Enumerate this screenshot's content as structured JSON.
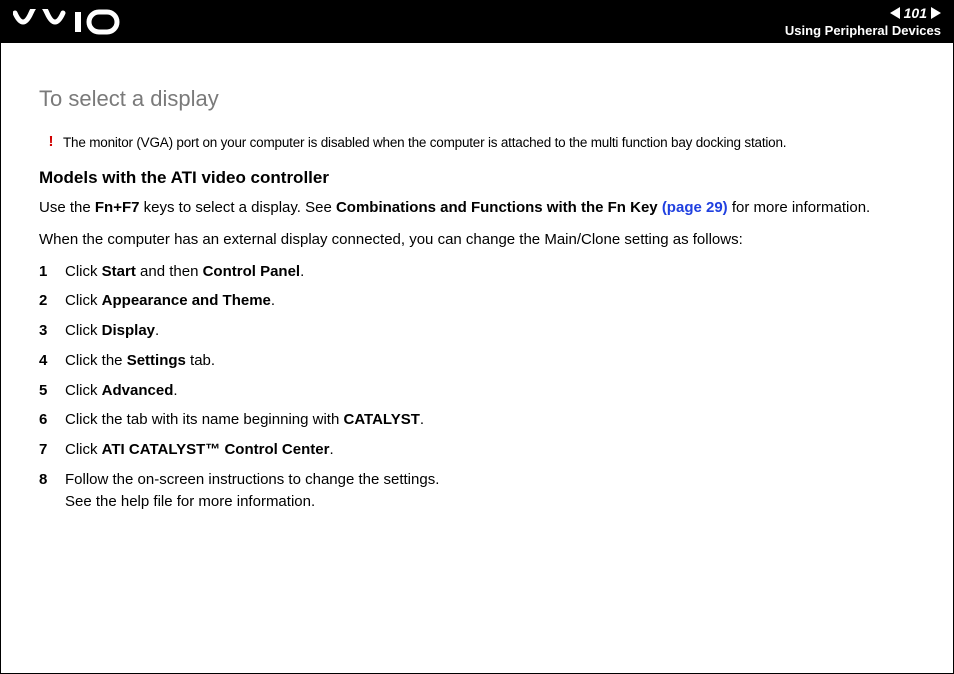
{
  "header": {
    "page_number": "101",
    "section_label": "Using Peripheral Devices"
  },
  "content": {
    "title": "To select a display",
    "note_mark": "!",
    "note_text": "The monitor (VGA) port on your computer is disabled when the computer is attached to the multi function bay docking station.",
    "subheading": "Models with the ATI video controller",
    "para1_pre": "Use the ",
    "para1_keys": "Fn+F7",
    "para1_mid": " keys to select a display. See ",
    "para1_link_label": "Combinations and Functions with the Fn Key",
    "para1_link_page": "(page 29)",
    "para1_post": " for more information.",
    "para2": "When the computer has an external display connected, you can change the Main/Clone setting as follows:",
    "steps": [
      {
        "n": "1",
        "pre": "Click ",
        "b1": "Start",
        "mid": " and then ",
        "b2": "Control Panel",
        "post": "."
      },
      {
        "n": "2",
        "pre": "Click ",
        "b1": "Appearance and Theme",
        "post": "."
      },
      {
        "n": "3",
        "pre": "Click ",
        "b1": "Display",
        "post": "."
      },
      {
        "n": "4",
        "pre": "Click the ",
        "b1": "Settings",
        "post": " tab."
      },
      {
        "n": "5",
        "pre": "Click ",
        "b1": "Advanced",
        "post": "."
      },
      {
        "n": "6",
        "pre": "Click the tab with its name beginning with ",
        "b1": "CATALYST",
        "post": "."
      },
      {
        "n": "7",
        "pre": "Click ",
        "b1": "ATI CATALYST™ Control Center",
        "post": "."
      },
      {
        "n": "8",
        "pre": "Follow the on-screen instructions to change the settings.",
        "post2": "See the help file for more information."
      }
    ]
  }
}
